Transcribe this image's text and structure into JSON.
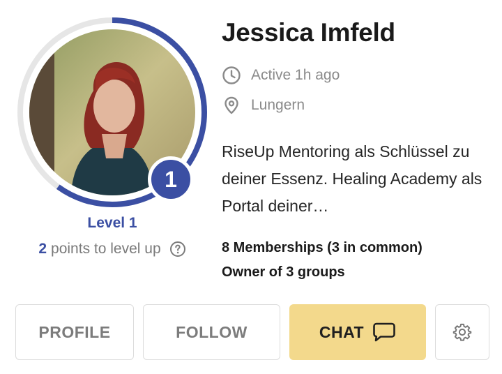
{
  "profile": {
    "name": "Jessica Imfeld",
    "active_status": "Active 1h ago",
    "location": "Lungern",
    "bio": "RiseUp Mentoring als Schlüssel zu deiner Essenz. Healing Academy als Portal deiner…",
    "memberships": "8 Memberships (3 in common)",
    "groups": "Owner of 3 groups"
  },
  "level": {
    "number": "1",
    "label": "Level 1",
    "points_needed": "2",
    "points_suffix": "points to level up",
    "progress_fraction": 0.6
  },
  "actions": {
    "profile_label": "PROFILE",
    "follow_label": "FOLLOW",
    "chat_label": "CHAT"
  },
  "icons": {
    "clock": "clock-icon",
    "location": "location-pin-icon",
    "help": "question-circle-icon",
    "chat": "chat-bubble-icon",
    "settings": "gear-icon"
  },
  "colors": {
    "accent": "#3b4fa3",
    "chat_button": "#f3d98c",
    "ring_track": "#e6e6e6"
  }
}
